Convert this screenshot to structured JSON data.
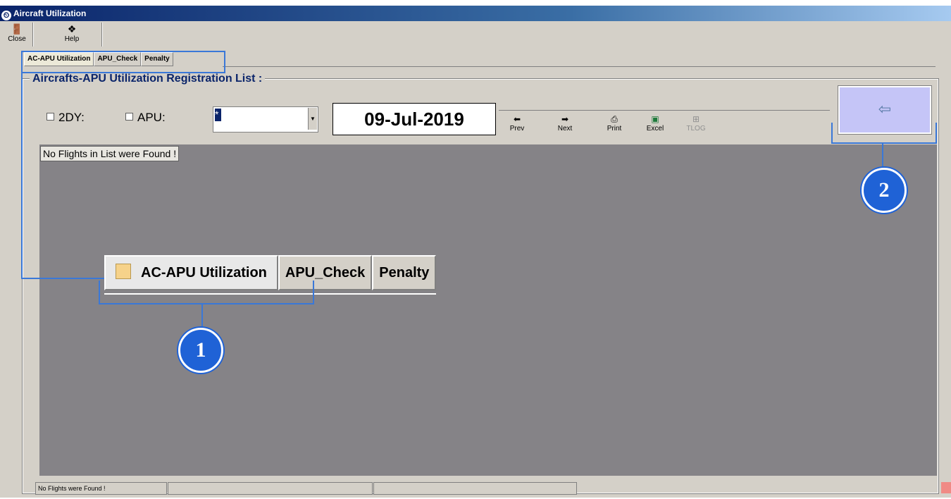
{
  "window": {
    "title": "Aircraft Utilization"
  },
  "toolbar": {
    "close_label": "Close",
    "help_label": "Help"
  },
  "tabs": [
    {
      "label": "AC-APU Utilization",
      "active": true
    },
    {
      "label": "APU_Check",
      "active": false
    },
    {
      "label": "Penalty",
      "active": false
    }
  ],
  "panel": {
    "title": "Aircrafts-APU Utilization Registration List :"
  },
  "filters": {
    "two_dy_label": "2DY:",
    "apu_label": "APU:",
    "apu_value": "*"
  },
  "date": "09-Jul-2019",
  "nav": {
    "prev": "Prev",
    "next": "Next",
    "print": "Print",
    "excel": "Excel",
    "tlog": "TLOG"
  },
  "back_button": {
    "icon": "arrow-left-icon",
    "glyph": "⇦"
  },
  "list": {
    "empty_message": "No Flights in List were Found !"
  },
  "status": {
    "message": "No Flights were Found !"
  },
  "callouts": {
    "badge1": "1",
    "badge2": "2"
  },
  "colors": {
    "highlight": "#3a78d8",
    "badge": "#1f62d6",
    "list_bg": "#858387",
    "title_blue": "#0a246a"
  }
}
